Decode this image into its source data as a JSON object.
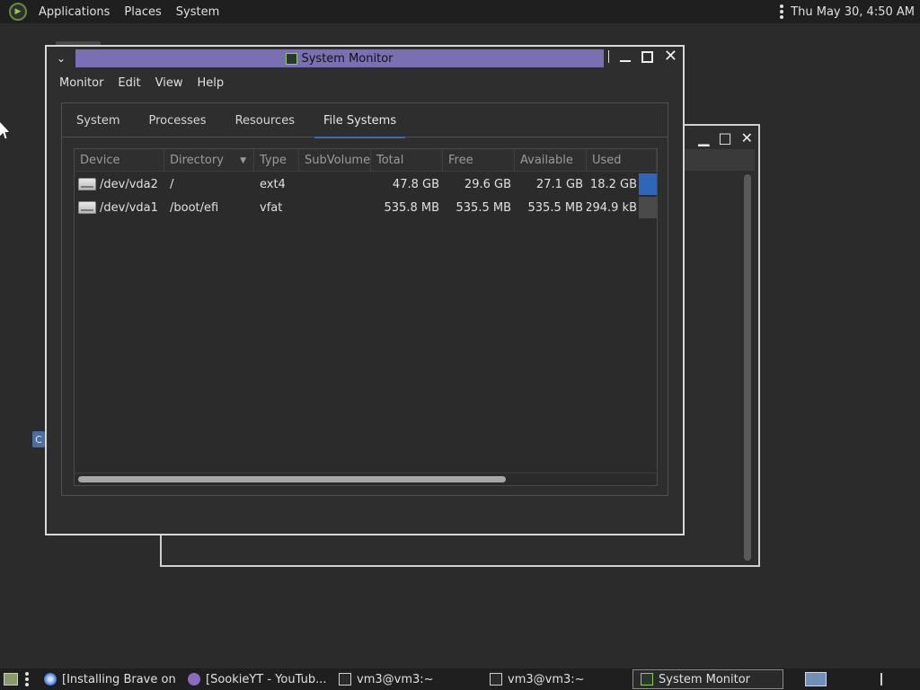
{
  "top_panel": {
    "menus": [
      "Applications",
      "Places",
      "System"
    ],
    "clock": "Thu May 30,  4:50 AM"
  },
  "window": {
    "title": "System Monitor",
    "menubar": [
      "Monitor",
      "Edit",
      "View",
      "Help"
    ],
    "tabs": [
      "System",
      "Processes",
      "Resources",
      "File Systems"
    ],
    "active_tab": "File Systems",
    "table": {
      "columns": [
        "Device",
        "Directory",
        "Type",
        "SubVolume",
        "Total",
        "Free",
        "Available",
        "Used"
      ],
      "sorted_column": "Directory",
      "rows": [
        {
          "device": "/dev/vda2",
          "directory": "/",
          "type": "ext4",
          "subvolume": "",
          "total": "47.8 GB",
          "free": "29.6 GB",
          "available": "27.1 GB",
          "used": "18.2 GB",
          "used_fraction": 0.38,
          "used_color": "#2f67b8"
        },
        {
          "device": "/dev/vda1",
          "directory": "/boot/efi",
          "type": "vfat",
          "subvolume": "",
          "total": "535.8 MB",
          "free": "535.5 MB",
          "available": "535.5 MB",
          "used": "294.9 kB",
          "used_fraction": 0.0,
          "used_color": "#4a4a4a"
        }
      ]
    }
  },
  "taskbar": {
    "items": [
      {
        "label": "[Installing Brave on ...",
        "icon": "browser-icon"
      },
      {
        "label": "[SookieYT - YouTub...",
        "icon": "tor-browser-icon"
      },
      {
        "label": "vm3@vm3:~",
        "icon": "terminal-icon"
      },
      {
        "label": "vm3@vm3:~",
        "icon": "terminal-icon"
      },
      {
        "label": "System Monitor",
        "icon": "system-monitor-icon",
        "active": true
      }
    ]
  },
  "colors": {
    "title_bar": "#7a6fb2",
    "tab_indicator": "#3b6bb0",
    "used_bar": "#2f67b8"
  }
}
